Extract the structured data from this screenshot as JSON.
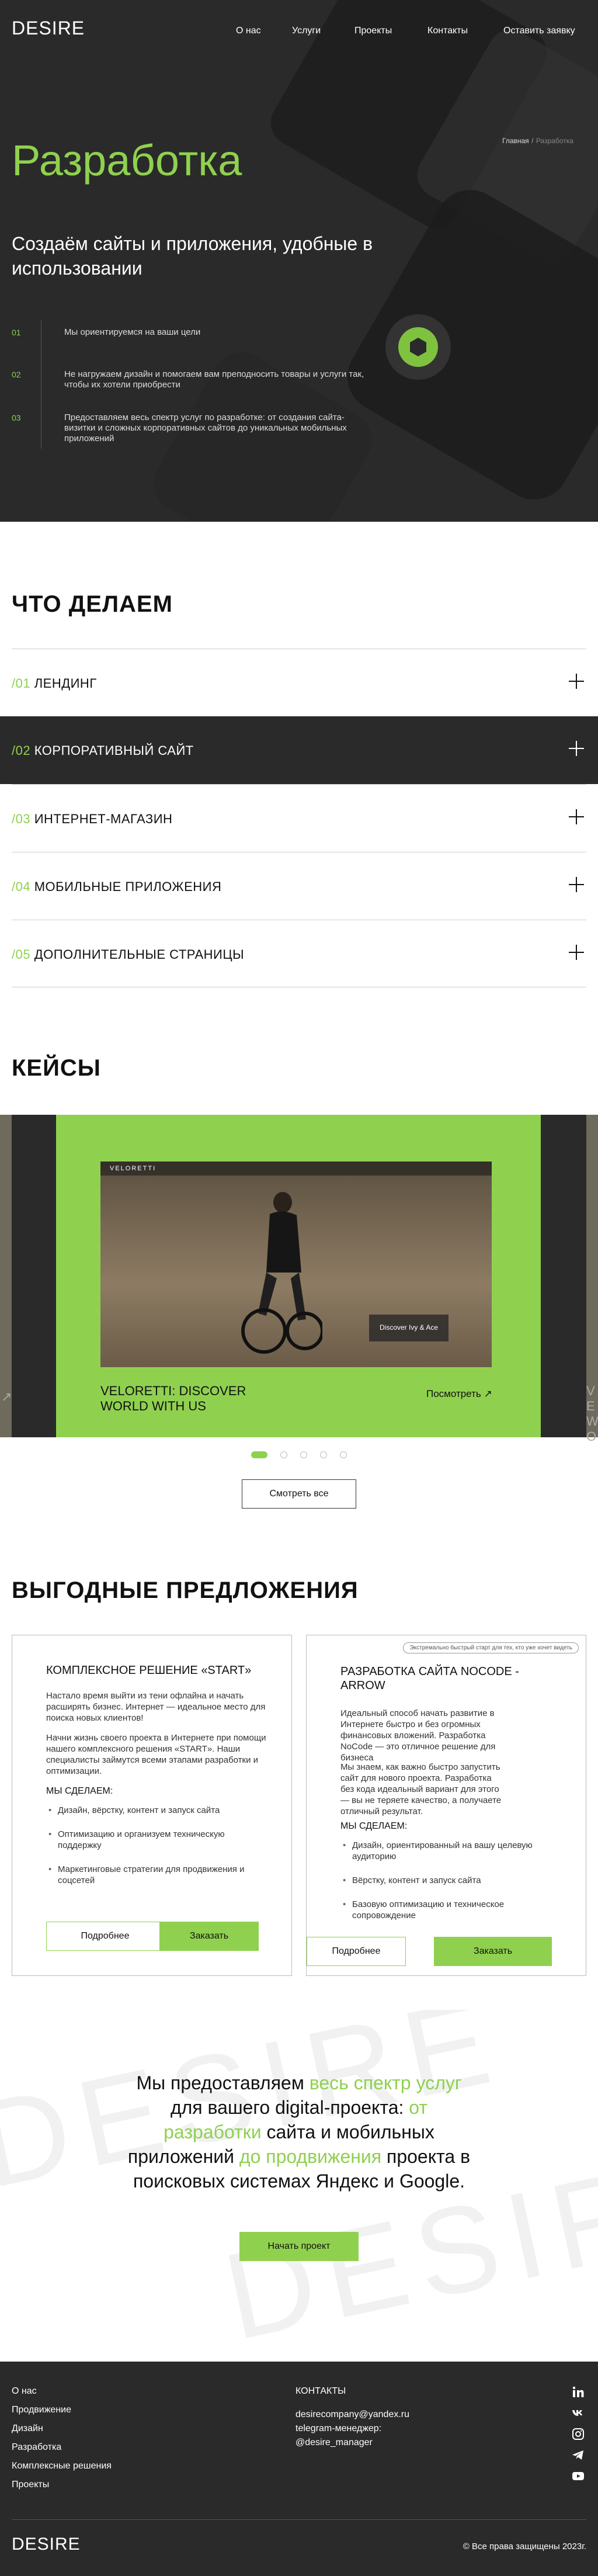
{
  "header": {
    "logo": "DESIRE",
    "nav": [
      "О нас",
      "Услуги",
      "Проекты",
      "Контакты",
      "Оставить заявку"
    ]
  },
  "breadcrumbs": {
    "home": "Главная",
    "sep": "/",
    "current": "Разработка"
  },
  "hero": {
    "title": "Разработка",
    "subtitle": "Создаём сайты и приложения, удобные в использовании",
    "steps": [
      {
        "num": "01",
        "text": "Мы ориентируемся на ваши цели"
      },
      {
        "num": "02",
        "text": "Не нагружаем дизайн и помогаем вам преподносить товары и услуги так, чтобы их хотели приобрести"
      },
      {
        "num": "03",
        "text": "Предоставляем весь спектр услуг по разработке: от создания сайта-визитки и сложных корпоративных сайтов до уникальных мобильных приложений"
      }
    ]
  },
  "what_we_do": {
    "title": "ЧТО ДЕЛАЕМ",
    "items": [
      {
        "num": "/01",
        "label": "ЛЕНДИНГ"
      },
      {
        "num": "/02",
        "label": "КОРПОРАТИВНЫЙ САЙТ"
      },
      {
        "num": "/03",
        "label": "ИНТЕРНЕТ-МАГАЗИН"
      },
      {
        "num": "/04",
        "label": "МОБИЛЬНЫЕ ПРИЛОЖЕНИЯ"
      },
      {
        "num": "/05",
        "label": "ДОПОЛНИТЕЛЬНЫЕ СТРАНИЦЫ"
      }
    ]
  },
  "cases": {
    "title": "КЕЙСЫ",
    "card": {
      "site_brand": "VELORETTI",
      "site_cta": "Discover Ivy & Ace",
      "name": "VELORETTI: DISCOVER WORLD WITH US",
      "link": "Посмотреть ↗"
    },
    "side_right": "VE WO",
    "side_left_arrow": "↗",
    "see_all": "Смотреть все"
  },
  "offers": {
    "title": "ВЫГОДНЫЕ ПРЕДЛОЖЕНИЯ",
    "items": [
      {
        "title": "КОМПЛЕКСНОЕ РЕШЕНИЕ «START»",
        "p1": "Настало время выйти из тени офлайна и начать расширять бизнес. Интернет — идеальное место для поиска новых клиентов!",
        "p2": "Начни жизнь своего проекта в Интернете при помощи нашего комплексного решения «START». Наши специалисты займутся всеми этапами разработки и оптимизации.",
        "sub": "МЫ СДЕЛАЕМ:",
        "list": [
          "Дизайн, вёрстку, контент и запуск сайта",
          "Оптимизацию и организуем техническую поддержку",
          "Маркетинговые стратегии для продвижения и соцсетей"
        ],
        "more": "Подробнее",
        "order": "Заказать"
      },
      {
        "tag": "Экстремально быстрый старт для тех, кто уже хочет видеть",
        "title": "РАЗРАБОТКА САЙТА NOCODE - ARROW",
        "p1": "Идеальный способ начать развитие в Интернете быстро и без огромных финансовых вложений. Разработка NoCode — это отличное решение для бизнеса",
        "p2": "Мы знаем, как важно быстро запустить сайт для нового проекта. Разработка без кода идеальный вариант для этого — вы не теряете качество, а получаете отличный результат.",
        "sub": "МЫ СДЕЛАЕМ:",
        "list": [
          "Дизайн, ориентированный на вашу целевую аудиторию",
          "Вёрстку, контент и запуск сайта",
          "Базовую оптимизацию и техническое сопровождение"
        ],
        "more": "Подробнее",
        "order": "Заказать"
      }
    ]
  },
  "promo": {
    "t1": "Мы предоставляем ",
    "g1": "весь спектр услуг",
    "t2": " для вашего digital-проекта: ",
    "g2": "от разработки",
    "t3": " сайта и мобильных приложений ",
    "g3": "до продвижения",
    "t4": " проекта в поисковых системах Яндекс и Google.",
    "button": "Начать проект",
    "watermark": "DESIRE"
  },
  "footer": {
    "links": [
      "О нас",
      "Продвижение",
      "Дизайн",
      "Разработка",
      "Комплексные решения",
      "Проекты"
    ],
    "contacts_title": "КОНТАКТЫ",
    "email": "desirecompany@yandex.ru",
    "tg_label": "telegram-менеджер:",
    "tg": "@desire_manager",
    "logo": "DESIRE",
    "copyright": "© Все права защищены 2023г."
  },
  "colors": {
    "accent": "#8fd14f",
    "dark": "#2a2a2a"
  }
}
